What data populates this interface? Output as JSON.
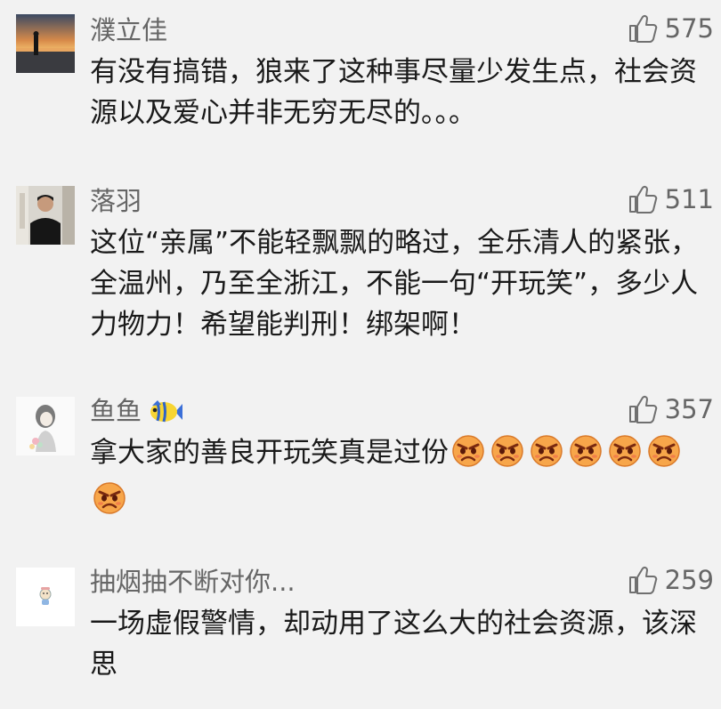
{
  "comments": [
    {
      "username": "濮立佳",
      "likes": "575",
      "text": "有没有搞错，狼来了这种事尽量少发生点，社会资源以及爱心并非无穷无尽的。。。",
      "avatar_icon": "sunset-photo-avatar"
    },
    {
      "username": "落羽",
      "likes": "511",
      "text": "这位“亲属”不能轻飘飘的略过，全乐清人的紧张，全温州，乃至全浙江，不能一句“开玩笑”，多少人力物力！希望能判刑！绑架啊！",
      "avatar_icon": "man-portrait-avatar"
    },
    {
      "username": "鱼鱼",
      "likes": "357",
      "text": "拿大家的善良开玩笑真是过份",
      "emoji_count": 7,
      "emoji_icon": "angry-face-icon",
      "badge_icon": "tropical-fish-icon",
      "avatar_icon": "girl-sketch-avatar"
    },
    {
      "username": "抽烟抽不断对你...",
      "likes": "259",
      "text": "一场虚假警情，却动用了这么大的社会资源，该深思",
      "avatar_icon": "cartoon-character-avatar"
    }
  ],
  "colors": {
    "background": "#f2f2f2",
    "username": "#666666",
    "text": "#1a1a1a",
    "like_icon": "#707070"
  }
}
